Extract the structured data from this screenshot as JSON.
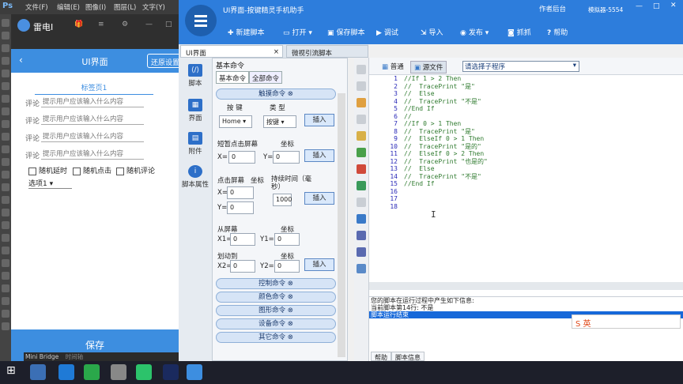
{
  "photoshop": {
    "logo": "Ps",
    "menus": [
      "文件(F)",
      "编辑(E)",
      "图像(I)",
      "图层(L)",
      "文字(Y)"
    ]
  },
  "emulator": {
    "title": "雷电I"
  },
  "phone": {
    "title": "UI界面",
    "reset_label": "还原设置",
    "tab": "标签页1",
    "comment_label": "评论",
    "placeholder": "提示用户应该输入什么内容",
    "checkboxes": [
      "随机延时",
      "随机点击",
      "随机评论"
    ],
    "select_value": "选项1",
    "save_label": "保存"
  },
  "mini_bridge": [
    "Mini Bridge",
    "时间轴"
  ],
  "app": {
    "title": "UI界面-按键精灵手机助手",
    "links": [
      "作者后台",
      "模拟器-5554"
    ],
    "toolbar": [
      "新建脚本",
      "打开",
      "保存脚本",
      "调试",
      "导入",
      "发布",
      "抓抓",
      "帮助"
    ],
    "doc_tabs": [
      "UI界面",
      "微视引流脚本"
    ],
    "side_items": [
      "脚本",
      "界面",
      "附件",
      "脚本属性"
    ]
  },
  "commands": {
    "title": "基本命令",
    "tabs": [
      "基本命令",
      "全部命令"
    ],
    "sections": [
      "触摸命令",
      "控制命令",
      "颜色命令",
      "图形命令",
      "设备命令",
      "其它命令"
    ],
    "key_label": "按 键",
    "type_label": "类 型",
    "key_value": "Home",
    "type_value": "按键",
    "insert": "插入",
    "tap_label": "短暂点击屏幕",
    "coord": "坐标",
    "x_eq": "X=",
    "y_eq": "Y=",
    "zero": "0",
    "press_label": "点击屏幕",
    "press_coord": "坐标",
    "duration_label": "持续时间（毫秒）",
    "duration_value": "1000",
    "from_label": "从屏幕",
    "x1": "X1=",
    "y1": "Y1=",
    "swipe_label": "划动到",
    "x2": "X2=",
    "y2": "Y2="
  },
  "editor": {
    "tabs": [
      "普通",
      "源文件"
    ],
    "sub_select": "请选择子程序",
    "line_numbers": [
      "1",
      "2",
      "3",
      "4",
      "5",
      "6",
      "7",
      "8",
      "9",
      "10",
      "11",
      "12",
      "13",
      "14",
      "15",
      "16",
      "17",
      "18"
    ],
    "code": [
      "//If 1 > 2 Then",
      "//  TracePrint \"是\"",
      "//  Else",
      "//  TracePrint \"不是\"",
      "//End If",
      "//",
      "//If 0 > 1 Then",
      "//  TracePrint \"是\"",
      "//  ElseIf 0 > 1 Then",
      "//  TracePrint \"是的\"",
      "//  ElseIf 0 > 2 Then",
      "//  TracePrint \"也是的\"",
      "//  Else",
      "//  TracePrint \"不是\"",
      "//End If",
      "",
      "",
      ""
    ],
    "output": [
      "您的脚本在运行过程中产生如下信息:",
      "当前脚本第14行: 不是",
      "脚本运行结束"
    ],
    "bottom_tabs": [
      "帮助",
      "脚本信息"
    ],
    "ime": "S 英"
  },
  "colors": {
    "accent": "#2d7ddc",
    "phone_accent": "#3d8ee0"
  }
}
